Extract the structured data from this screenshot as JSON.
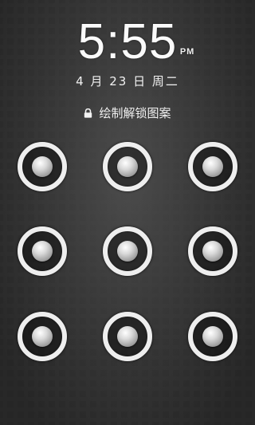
{
  "clock": {
    "time": "5:55",
    "ampm": "PM",
    "date": "4 月 23 日  周二"
  },
  "unlock": {
    "hint": "绘制解锁图案",
    "hint_icon": "lock-icon"
  },
  "pattern": {
    "rows": 3,
    "columns": 3,
    "node_color": "#eeeeee"
  }
}
